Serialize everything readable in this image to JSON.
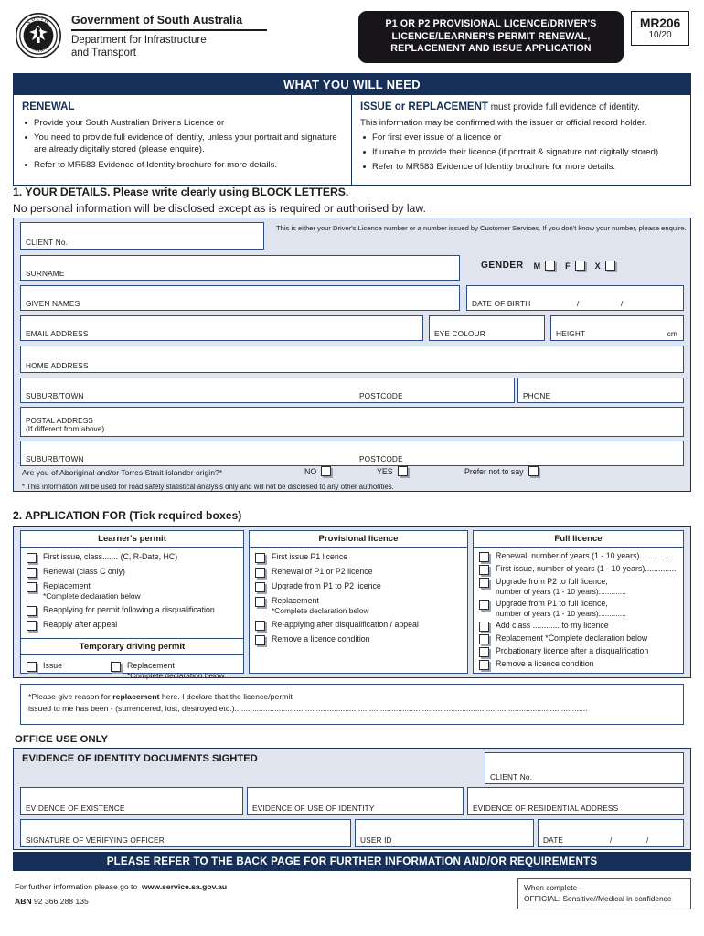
{
  "header": {
    "crest_icon": "sa-piping-shrike-crest",
    "gov_title": "Government of South Australia",
    "dept_line1": "Department for Infrastructure",
    "dept_line2": "and Transport",
    "form_title": "P1 OR P2 PROVISIONAL LICENCE/DRIVER'S LICENCE/LEARNER'S PERMIT RENEWAL, REPLACEMENT AND ISSUE APPLICATION",
    "form_code": "MR206",
    "form_version": "10/20"
  },
  "what_you_need": {
    "bar_title": "WHAT YOU WILL NEED",
    "renewal": {
      "heading": "RENEWAL",
      "items": [
        "Provide your South Australian Driver's Licence or",
        "You need to provide full evidence of identity, unless your portrait and signature are already digitally stored (please enquire).",
        "Refer to MR583 Evidence of Identity brochure for more details."
      ]
    },
    "issue": {
      "heading": "ISSUE or REPLACEMENT",
      "heading_sub": " must provide full evidence of identity.",
      "lead": "This information may be confirmed with the issuer or official record holder.",
      "items": [
        "For first ever issue of a licence or",
        "If unable to provide their licence (if portrait & signature not digitally stored)",
        "Refer to MR583 Evidence of Identity brochure for more details."
      ]
    }
  },
  "section1": {
    "title": "1. YOUR DETAILS. Please write clearly using BLOCK LETTERS.",
    "subtitle": "No personal information will be disclosed except as is required or authorised by law.",
    "client_no_label": "CLIENT No.",
    "client_hint": "This is either your Driver's Licence number or a number issued by Customer Services. If you don't know your number, please enquire.",
    "surname_label": "SURNAME",
    "gender_label": "GENDER",
    "gender_options": [
      "M",
      "F",
      "X"
    ],
    "given_names_label": "GIVEN NAMES",
    "dob_label": "DATE OF BIRTH",
    "dob_sep1": "/",
    "dob_sep2": "/",
    "email_label": "EMAIL ADDRESS",
    "eye_colour_label": "EYE COLOUR",
    "height_label": "HEIGHT",
    "height_unit": "cm",
    "home_address_label": "HOME ADDRESS",
    "suburb_label": "SUBURB/TOWN",
    "postcode_label": "POSTCODE",
    "phone_label": "PHONE",
    "postal_address_label1": "POSTAL ADDRESS",
    "postal_address_label2": "(If different from above)",
    "postal_suburb_label": "SUBURB/TOWN",
    "postal_postcode_label": "POSTCODE",
    "atsi_question": "Are you of Aboriginal and/or Torres Strait Islander origin?*",
    "atsi_options": [
      "NO",
      "YES",
      "Prefer not to say"
    ],
    "atsi_note": "* This information will be used for road safety statistical analysis only and will not be disclosed to any other authorities."
  },
  "section2": {
    "title": "2. APPLICATION FOR (Tick required boxes)",
    "columns": [
      {
        "heading": "Learner's permit",
        "options": [
          {
            "text": "First issue, class....... (C, R-Date, HC)"
          },
          {
            "text": "Renewal (class C only)"
          },
          {
            "text": "Replacement",
            "note": "*Complete declaration below"
          },
          {
            "text": "Reapplying for permit following a disqualification"
          },
          {
            "text": "Reapply after appeal"
          }
        ],
        "sub_heading": "Temporary driving permit",
        "sub_options": [
          {
            "text": "Issue"
          },
          {
            "text": "Replacement",
            "note": "*Complete declaration below"
          }
        ]
      },
      {
        "heading": "Provisional licence",
        "options": [
          {
            "text": "First issue P1 licence"
          },
          {
            "text": "Renewal of P1 or P2 licence"
          },
          {
            "text": "Upgrade from P1 to P2 licence"
          },
          {
            "text": "Replacement",
            "note": "*Complete declaration below"
          },
          {
            "text": "Re-applying after disqualification / appeal"
          },
          {
            "text": "Remove a licence condition"
          }
        ]
      },
      {
        "heading": "Full licence",
        "options": [
          {
            "text": "Renewal, number of years (1 - 10 years).............."
          },
          {
            "text": "First issue, number of years (1 - 10 years).............."
          },
          {
            "text": "Upgrade from P2 to full licence,",
            "note": "number of years (1 - 10 years)............."
          },
          {
            "text": "Upgrade from P1 to full licence,",
            "note": "number of years (1 - 10 years)............."
          },
          {
            "text": "Add class ............ to my licence"
          },
          {
            "text": "Replacement *Complete declaration below"
          },
          {
            "text": "Probationary licence after a disqualification"
          },
          {
            "text": "Remove a licence condition"
          }
        ]
      }
    ],
    "reason_line1_pre": "*Please give reason for ",
    "reason_line1_bold": "replacement",
    "reason_line1_post": " here. I declare that the licence/permit",
    "reason_line2": "issued to me has been - (surrendered, lost, destroyed etc.)................................................................................................................................................................"
  },
  "office_use": {
    "label": "OFFICE USE ONLY",
    "eoi_title": "EVIDENCE OF IDENTITY DOCUMENTS SIGHTED",
    "client_no_label": "CLIENT No.",
    "evidence_existence": "EVIDENCE OF EXISTENCE",
    "evidence_use_identity": "EVIDENCE OF USE OF IDENTITY",
    "evidence_residential": "EVIDENCE OF RESIDENTIAL ADDRESS",
    "signature_label": "SIGNATURE OF VERIFYING OFFICER",
    "user_id_label": "USER ID",
    "date_label": "DATE",
    "date_sep1": "/",
    "date_sep2": "/"
  },
  "back_page_bar": "PLEASE REFER TO THE BACK PAGE FOR FURTHER INFORMATION AND/OR REQUIREMENTS",
  "footer": {
    "info_text": "For further information please go to",
    "website": "www.service.sa.gov.au",
    "abn_label": "ABN",
    "abn_value": "92 366 288 135",
    "when_complete_line1": "When complete –",
    "when_complete_line2": "OFFICIAL: Sensitive//Medical in confidence"
  },
  "colors": {
    "navy": "#17305a",
    "field_border": "#2c4c82",
    "panel_fill": "#dfe4ee",
    "badge": "#17141a"
  }
}
